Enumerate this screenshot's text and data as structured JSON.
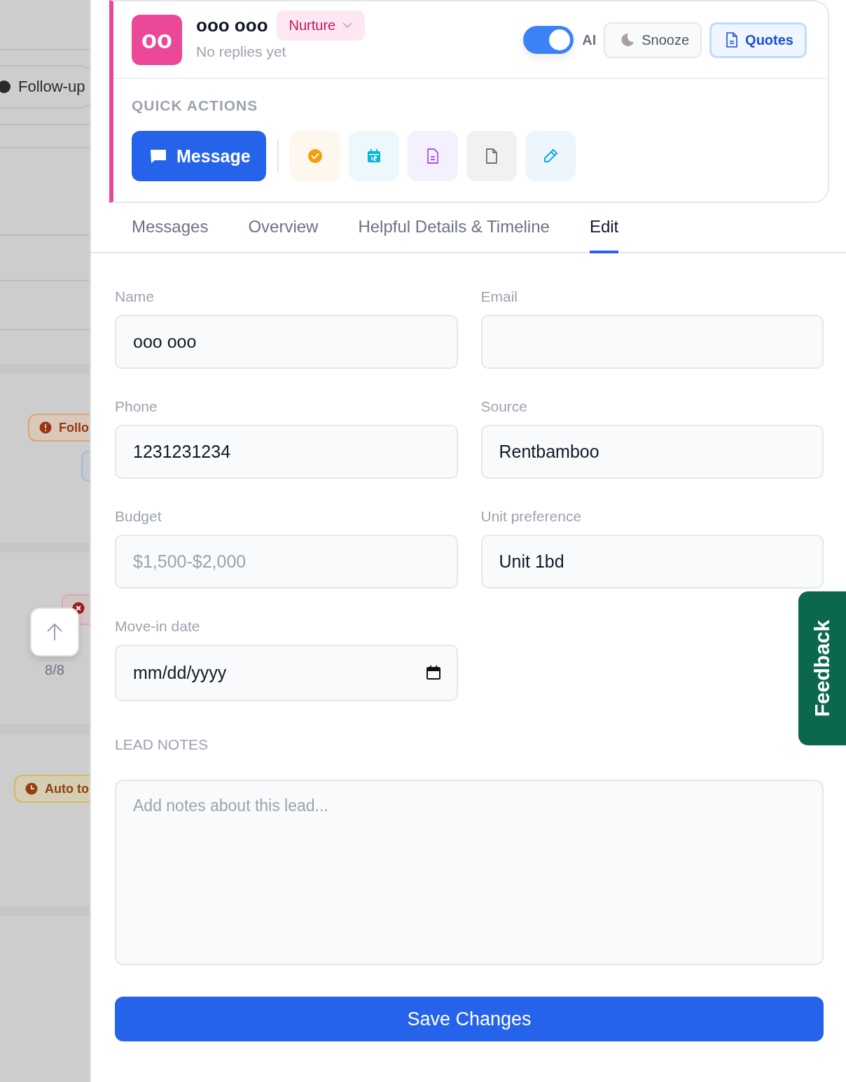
{
  "background": {
    "chips": [
      {
        "label": "Follow-up",
        "kind": "dark"
      },
      {
        "label": "Follo",
        "kind": "alert"
      },
      {
        "label": "Auto to",
        "kind": "clock"
      }
    ],
    "scroll_counter": "8/8"
  },
  "lead": {
    "initials": "oo",
    "name": "ooo ooo",
    "stage": "Nurture",
    "subtitle": "No replies yet",
    "ai": {
      "label": "AI",
      "on": true
    },
    "buttons": [
      {
        "label": "Snooze",
        "kind": "snooze",
        "selected": false
      },
      {
        "label": "Quotes",
        "kind": "quotes",
        "selected": true
      }
    ]
  },
  "quick_actions": {
    "title": "QUICK ACTIONS",
    "primary": "Message",
    "actions": [
      {
        "kind": "task"
      },
      {
        "kind": "calendar"
      },
      {
        "kind": "document"
      },
      {
        "kind": "file"
      },
      {
        "kind": "edit"
      }
    ]
  },
  "tabs": [
    {
      "label": "Messages",
      "selected": false
    },
    {
      "label": "Overview",
      "selected": false
    },
    {
      "label": "Helpful Details & Timeline",
      "selected": false
    },
    {
      "label": "Edit",
      "selected": true
    }
  ],
  "form": {
    "fields": [
      {
        "label": "Name",
        "value": "ooo ooo"
      },
      {
        "label": "Email"
      },
      {
        "label": "Phone",
        "value": "1231231234"
      },
      {
        "label": "Source",
        "value": "Rentbamboo"
      },
      {
        "label": "Budget",
        "placeholder": "$1,500-$2,000"
      },
      {
        "label": "Unit preference",
        "value": "Unit 1bd"
      },
      {
        "label": "Move-in date",
        "placeholder": "mm/dd/yyyy",
        "kind": "date"
      }
    ],
    "notes_title": "LEAD NOTES",
    "notes_placeholder": "Add notes about this lead...",
    "save": "Save Changes"
  },
  "feedback": "Feedback"
}
